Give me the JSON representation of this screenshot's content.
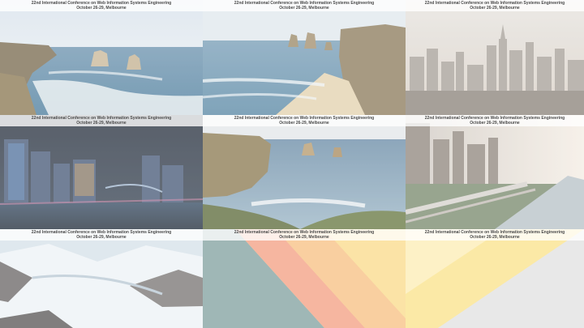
{
  "slide_header": {
    "line1": "22nd International Conference on Web Information Systems Engineering",
    "line2": "October 26-29, Melbourne"
  },
  "tiles": [
    {
      "id": "coast-rocks",
      "icon": "coastline-photo"
    },
    {
      "id": "coast-beach",
      "icon": "beach-cliff-photo"
    },
    {
      "id": "city-day",
      "icon": "city-skyline-photo"
    },
    {
      "id": "city-night",
      "icon": "night-city-photo"
    },
    {
      "id": "apostles",
      "icon": "sea-stacks-photo"
    },
    {
      "id": "city-river",
      "icon": "city-river-photo"
    },
    {
      "id": "snow-peaks",
      "icon": "snow-mountain-photo"
    },
    {
      "id": "stripes",
      "icon": "diagonal-stripes-graphic"
    },
    {
      "id": "yellow-triangle",
      "icon": "yellow-triangle-graphic"
    }
  ]
}
